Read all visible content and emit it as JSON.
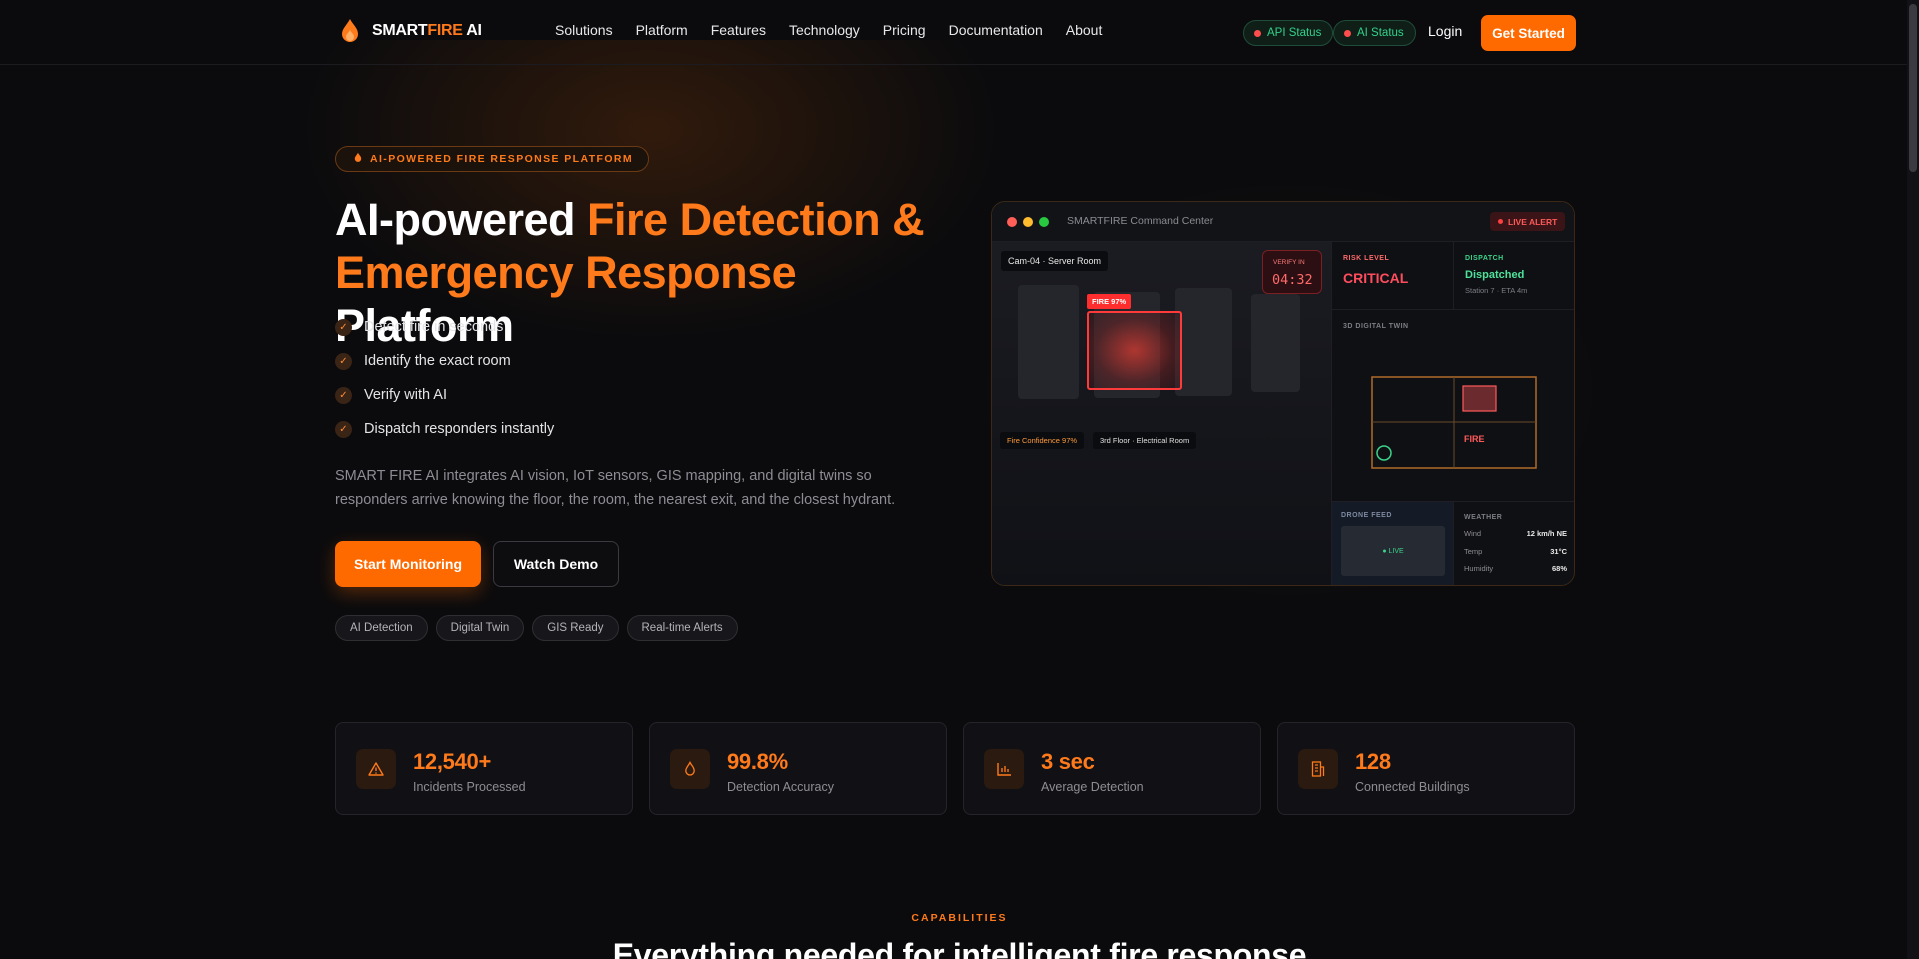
{
  "brand": {
    "prefix": "SMART",
    "accent": "FIRE",
    "suffix": " AI",
    "accent_color": "#ff7a1a"
  },
  "nav": {
    "items": [
      "Solutions",
      "Platform",
      "Features",
      "Technology",
      "Pricing",
      "Documentation",
      "About"
    ],
    "api_status": "API Status",
    "ai_status": "AI Status",
    "login": "Login",
    "get_started": "Get Started"
  },
  "hero": {
    "badge": "AI-POWERED FIRE RESPONSE PLATFORM",
    "title_1": "AI-powered ",
    "title_2": "Fire Detection &",
    "title_3": "Emergency Response",
    "title_4": " Platform",
    "checks": [
      "Detect fire in seconds",
      "Identify the exact room",
      "Verify with AI",
      "Dispatch responders instantly"
    ],
    "description": "SMART FIRE AI integrates AI vision, IoT sensors, GIS mapping, and digital twins so responders arrive knowing the floor, the room, the nearest exit, and the closest hydrant.",
    "primary_cta": "Start Monitoring",
    "secondary_cta": "Watch Demo",
    "tags": [
      "AI Detection",
      "Digital Twin",
      "GIS Ready",
      "Real-time Alerts"
    ]
  },
  "command_center": {
    "title": "SMARTFIRE Command Center",
    "live_alert": "LIVE ALERT",
    "camera": "Cam-04 · Server Room",
    "fire_tag": "FIRE 97%",
    "verify_label": "VERIFY IN",
    "verify_timer": "04:32",
    "confidence": "Fire Confidence 97%",
    "location": "3rd Floor · Electrical Room",
    "risk_label": "RISK LEVEL",
    "risk_value": "CRITICAL",
    "dispatch_label": "DISPATCH",
    "dispatch_value": "Dispatched",
    "dispatch_detail": "Station 7 · ETA 4m",
    "twin_label": "3D DIGITAL TWIN",
    "twin_fire": "FIRE",
    "drone_label": "DRONE FEED",
    "drone_live": "● LIVE",
    "weather_label": "WEATHER",
    "weather": [
      {
        "k": "Wind",
        "v": "12 km/h NE"
      },
      {
        "k": "Temp",
        "v": "31°C"
      },
      {
        "k": "Humidity",
        "v": "68%"
      }
    ]
  },
  "stats": [
    {
      "icon": "warning-icon",
      "value": "12,540+",
      "label": "Incidents Processed"
    },
    {
      "icon": "flame-icon",
      "value": "99.8%",
      "label": "Detection Accuracy"
    },
    {
      "icon": "bar-chart-icon",
      "value": "3 sec",
      "label": "Average Detection"
    },
    {
      "icon": "building-icon",
      "value": "128",
      "label": "Connected Buildings"
    }
  ],
  "capabilities": {
    "eyebrow": "CAPABILITIES",
    "heading": "Everything needed for intelligent fire response"
  }
}
